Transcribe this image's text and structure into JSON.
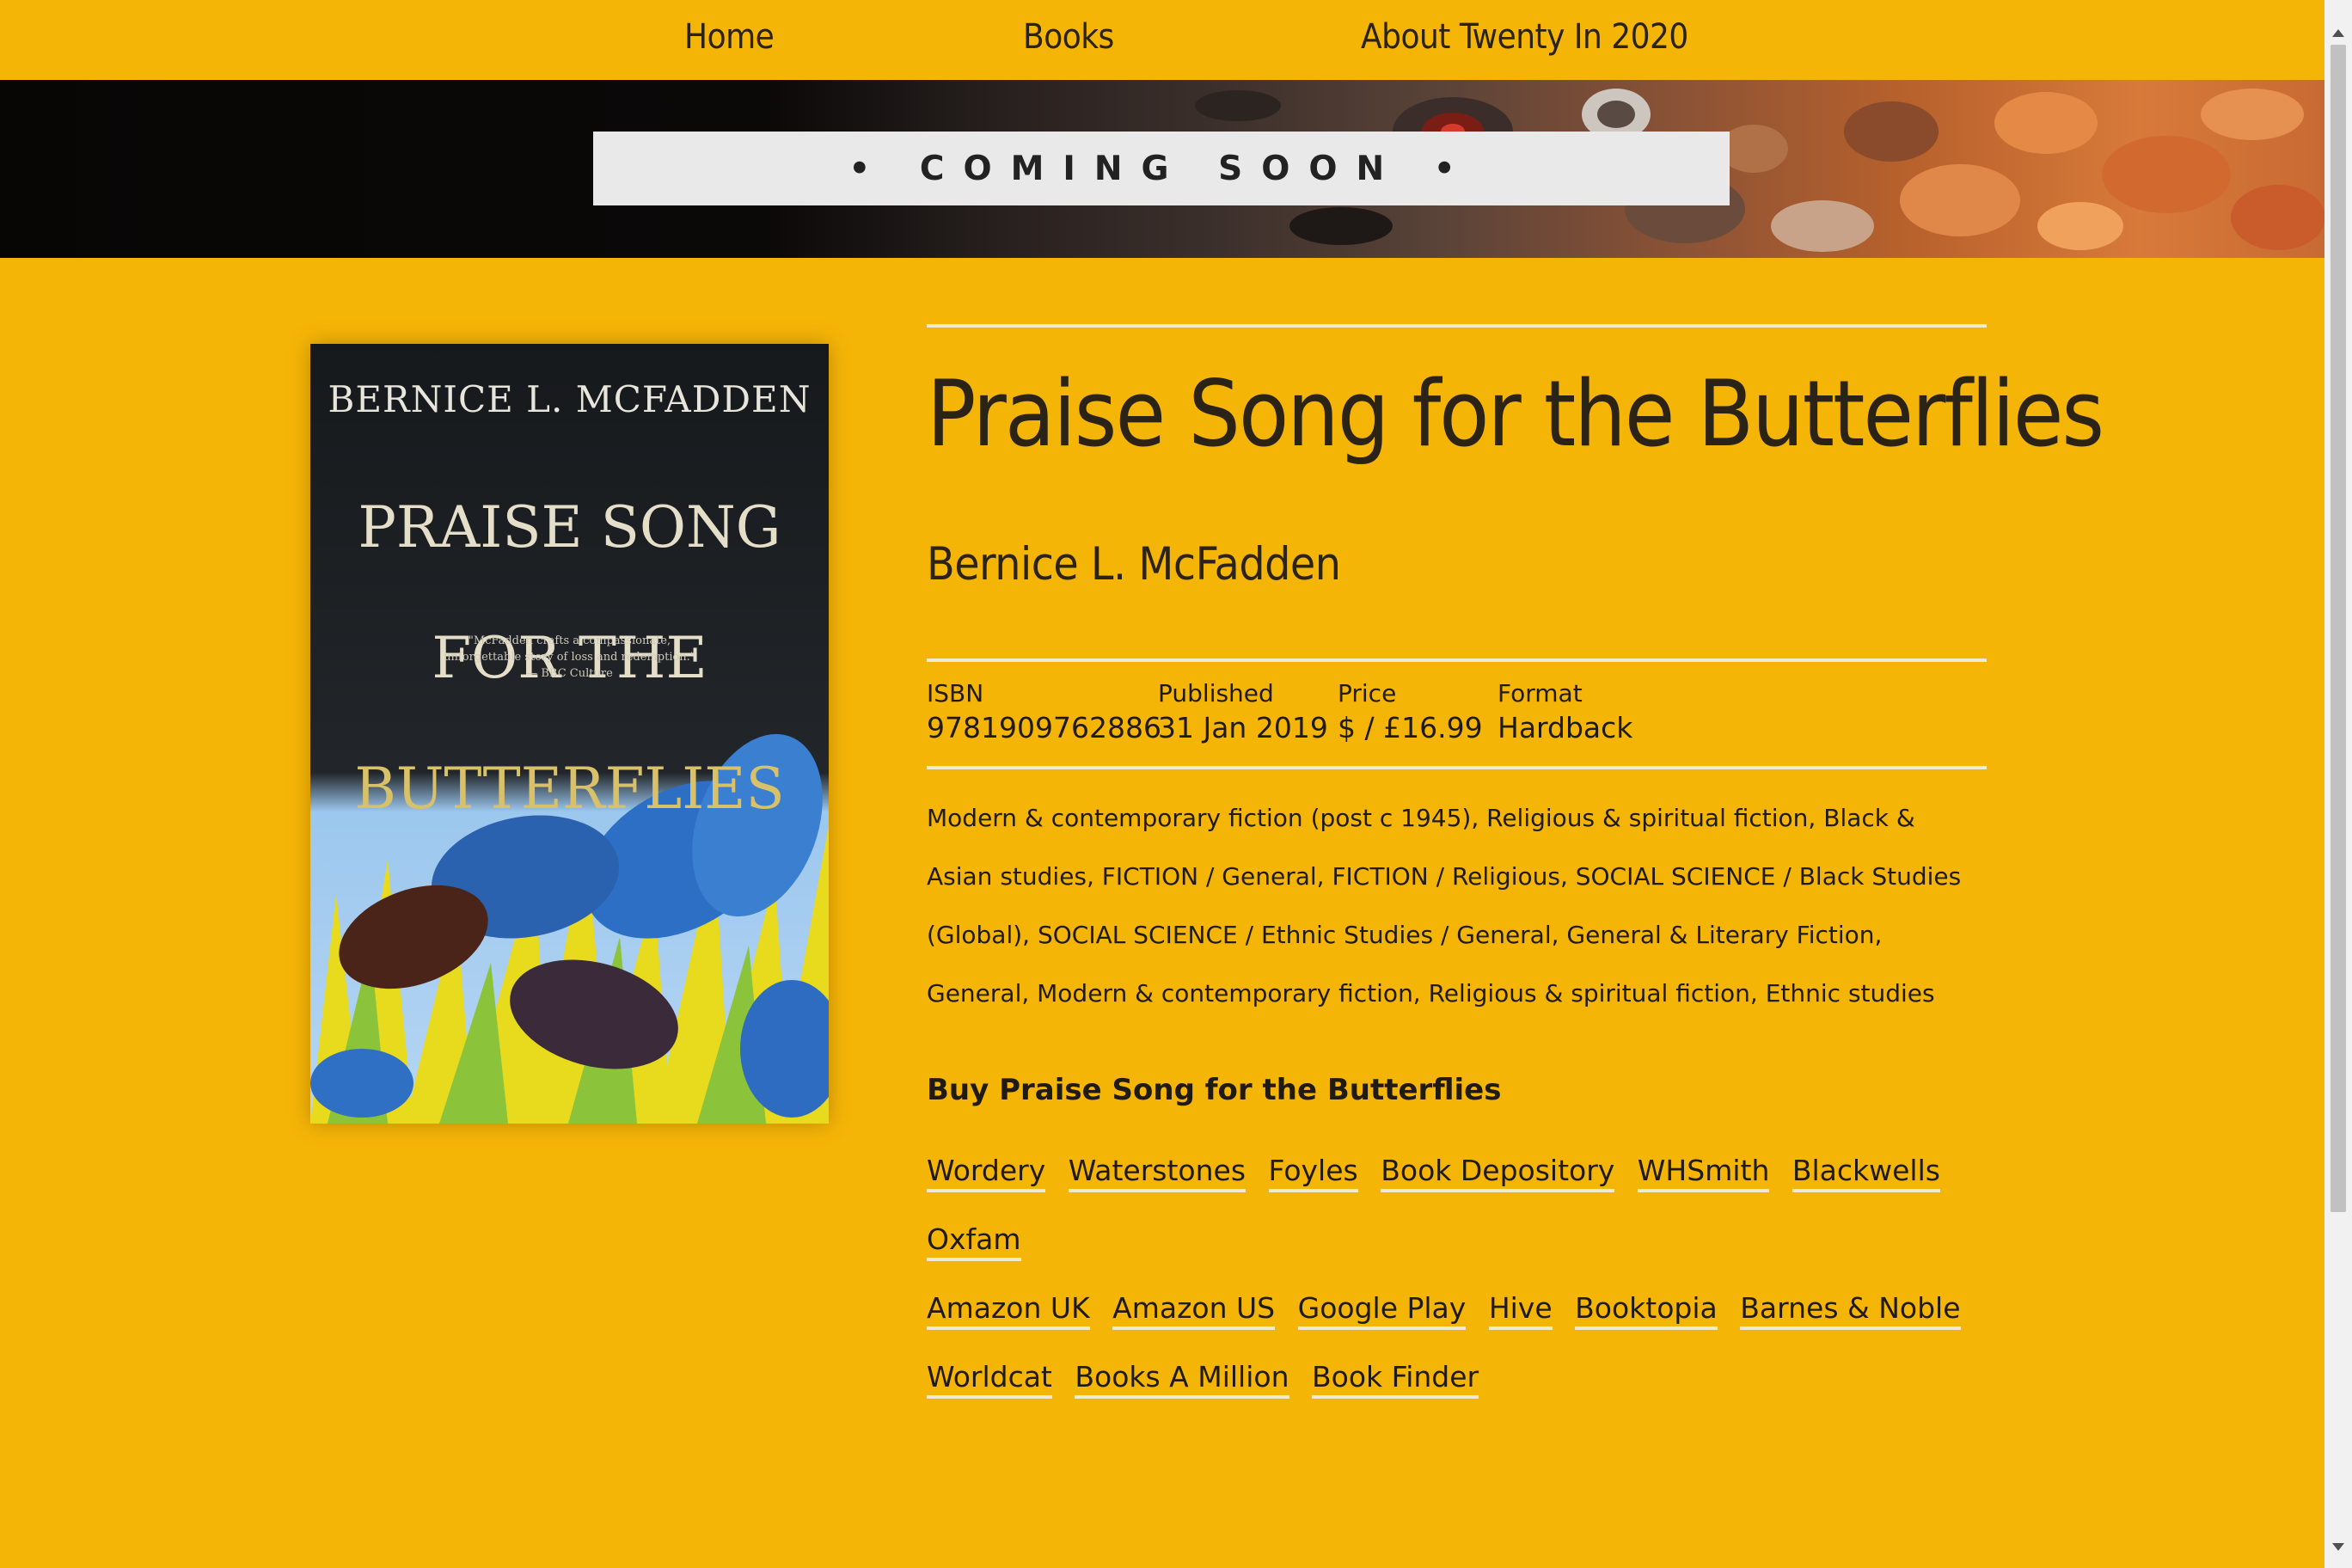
{
  "nav": {
    "items": [
      {
        "label": "Home"
      },
      {
        "label": "Books"
      },
      {
        "label": "About Twenty In 2020"
      }
    ]
  },
  "banner": {
    "label": "• COMING SOON •"
  },
  "cover": {
    "author": "BERNICE L. MCFADDEN",
    "title_line1": "PRAISE SONG",
    "title_line2": "FOR THE",
    "title_line3": "BUTTERFLIES",
    "quote": "\"McFadden crafts a compassionate,\nunforgettable story of loss and redemption.\"\n— BBC Culture"
  },
  "book": {
    "title": "Praise Song for the Butterflies",
    "author": "Bernice L. McFadden",
    "meta": {
      "isbn_label": "ISBN",
      "isbn": "9781909762886",
      "published_label": "Published",
      "published": "31 Jan 2019",
      "price_label": "Price",
      "price": "$ / £16.99",
      "format_label": "Format",
      "format": "Hardback"
    },
    "subjects": "Modern & contemporary fiction (post c 1945), Religious & spiritual fiction, Black & Asian studies, FICTION / General, FICTION / Religious, SOCIAL SCIENCE / Black Studies (Global), SOCIAL SCIENCE / Ethnic Studies / General, General & Literary Fiction, General, Modern & contemporary fiction, Religious & spiritual fiction, Ethnic studies"
  },
  "buy": {
    "heading": "Buy Praise Song for the Butterflies",
    "stores": [
      "Wordery",
      "Waterstones",
      "Foyles",
      "Book Depository",
      "WHSmith",
      "Blackwells",
      "Oxfam",
      "Amazon UK",
      "Amazon US",
      "Google Play",
      "Hive",
      "Booktopia",
      "Barnes & Noble",
      "Worldcat",
      "Books A Million",
      "Book Finder"
    ]
  },
  "colors": {
    "page_background": "#f5b507",
    "rule": "#f3ead2",
    "text": "#1f1a12"
  }
}
